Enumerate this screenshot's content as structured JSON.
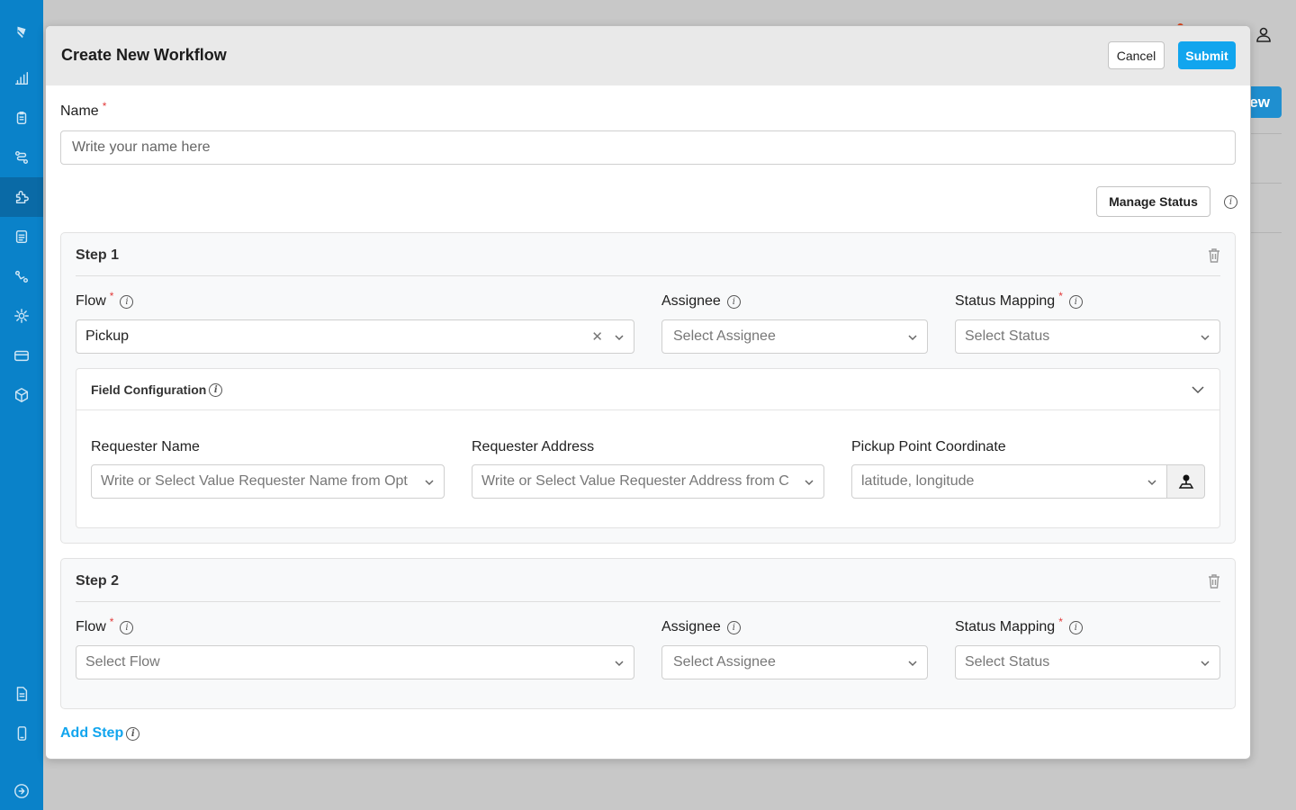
{
  "sidebar": {
    "icons": [
      "logo-icon",
      "chart-icon",
      "clipboard-icon",
      "route-icon",
      "puzzle-icon",
      "document-icon",
      "path-icon",
      "gear-icon",
      "card-icon",
      "box-icon",
      "file-icon",
      "phone-icon",
      "arrow-right-circle-icon"
    ]
  },
  "background": {
    "new_button_label": "ew"
  },
  "modal": {
    "title": "Create New Workflow",
    "cancel_label": "Cancel",
    "submit_label": "Submit",
    "name_label": "Name",
    "name_placeholder": "Write your name here",
    "manage_status_label": "Manage Status",
    "add_step_label": "Add Step"
  },
  "steps": [
    {
      "title": "Step 1",
      "flow_label": "Flow",
      "flow_value": "Pickup",
      "assignee_label": "Assignee",
      "assignee_placeholder": "Select Assignee",
      "status_label": "Status Mapping",
      "status_placeholder": "Select Status",
      "field_config": {
        "title": "Field Configuration",
        "fields": [
          {
            "label": "Requester Name",
            "placeholder": "Write or Select Value Requester Name from Opt"
          },
          {
            "label": "Requester Address",
            "placeholder": "Write or Select Value Requester Address from C"
          },
          {
            "label": "Pickup Point Coordinate",
            "placeholder": "latitude, longitude"
          }
        ]
      }
    },
    {
      "title": "Step 2",
      "flow_label": "Flow",
      "flow_placeholder": "Select Flow",
      "assignee_label": "Assignee",
      "assignee_placeholder": "Select Assignee",
      "status_label": "Status Mapping",
      "status_placeholder": "Select Status"
    }
  ],
  "colors": {
    "sidebar": "#0a82c9",
    "primary": "#11a5ee",
    "required": "#e23a3a"
  }
}
